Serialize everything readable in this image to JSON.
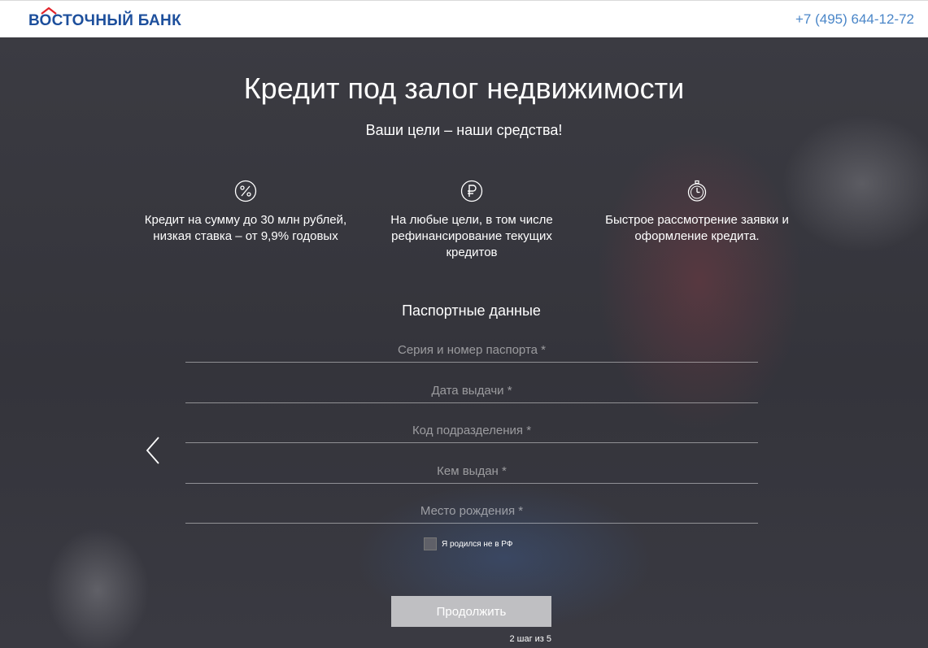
{
  "header": {
    "logo_text": "ВОСТОЧНЫЙ БАНК",
    "phone": "+7 (495) 644-12-72",
    "logo_color": "#1d4f9c",
    "phone_color": "#4a86c8"
  },
  "hero": {
    "title": "Кредит под залог недвижимости",
    "subtitle": "Ваши цели – наши средства!"
  },
  "features": [
    {
      "icon": "percent-icon",
      "line1": "Кредит на сумму до 30 млн рублей,",
      "line2": "низкая ставка – от 9,9% годовых",
      "line3": ""
    },
    {
      "icon": "ruble-icon",
      "line1": "На любые цели, в том числе",
      "line2": "рефинансирование текущих",
      "line3": "кредитов"
    },
    {
      "icon": "stopwatch-icon",
      "line1": "Быстрое рассмотрение заявки и",
      "line2": "оформление кредита.",
      "line3": ""
    }
  ],
  "form": {
    "title": "Паспортные данные",
    "fields": [
      {
        "placeholder": "Серия и номер паспорта *"
      },
      {
        "placeholder": "Дата выдачи *"
      },
      {
        "placeholder": "Код подразделения *"
      },
      {
        "placeholder": "Кем выдан *"
      },
      {
        "placeholder": "Место рождения *"
      }
    ],
    "checkbox_label": "Я родился не в РФ",
    "continue_label": "Продолжить",
    "step_text": "2 шаг из 5"
  }
}
